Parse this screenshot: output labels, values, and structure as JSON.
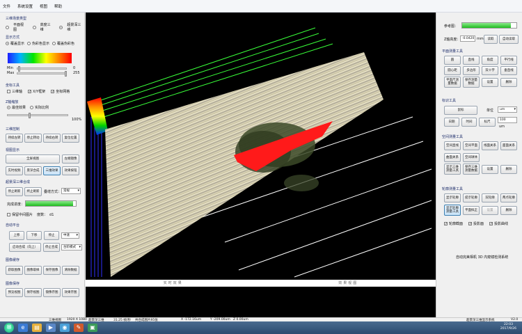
{
  "menu": [
    "文件",
    "系统设置",
    "视图",
    "帮助"
  ],
  "left": {
    "display_type_title": "三维场景类型",
    "display_types": [
      "平面视图",
      "高度三维",
      "超景深三维"
    ],
    "display_mode_title": "显示方式",
    "display_modes": [
      "覆盖显示",
      "伪彩色显示",
      "覆盖伪彩色"
    ],
    "min_label": "Min",
    "min_value": "0",
    "max_label": "Max",
    "max_value": "255",
    "axis_title": "坐标工具",
    "axis_items": [
      "三维轴",
      "X/Y框架",
      "坐标网格"
    ],
    "z_title": "Z轴缩放",
    "z_options": [
      "最佳效果",
      "实际比例"
    ],
    "z_percent": "100%",
    "control_title": "三维控制",
    "control_buttons": [
      "持续左转",
      "停止转动",
      "持续右转",
      "复位位置"
    ],
    "view_title": "视图显示",
    "full_view": "全屏视图",
    "horizontal_mirror": "左端镜像",
    "view_buttons": [
      "实时视频",
      "景深合成",
      "三维效果",
      "效果按钮"
    ],
    "stack_title": "超景深三维合成",
    "stack_buttons": [
      "停止刷新",
      "终止刷新"
    ],
    "stack_mode_label": "叠增方式：",
    "stack_mode_value": "常规",
    "progress_label": "完成进度：",
    "progress_fraction": 0.95,
    "keep_label": "保留中间图片",
    "step_label": "度数：",
    "step_value": "d1",
    "auto_title": "自动平台",
    "auto_buttons": [
      "上移",
      "下移",
      "停止"
    ],
    "speed_value": "中速",
    "auto_stack_button": "启动合成（向上）",
    "stop_stack_button": "停止合成",
    "auto_mode_value": "台阶模式",
    "image_title": "图像缓存",
    "image_buttons": [
      "获取图像",
      "图像取样",
      "保存图像",
      "清除数据"
    ],
    "save_title": "图像保存",
    "save_buttons": [
      "预览视图",
      "保存视图",
      "镜像存图",
      "效果存图"
    ]
  },
  "right": {
    "progress_label": "参考图：",
    "progress_fraction": 0.9,
    "z_height_label": "Z轴高度：",
    "z_height_value": "-0.0420",
    "z_height_unit": "mm",
    "read_button": "读取",
    "auto_read_button": "自动读取",
    "plane_title": "平面测量工具",
    "plane_buttons": [
      "圆",
      "直线",
      "角度",
      "平行线",
      "圆心距",
      "多边形",
      "双十字",
      "垂直线",
      "平面尺测量数据",
      "保存测量数据",
      "设置",
      "删除"
    ],
    "other_title": "标识工具",
    "cursor_button": "鼠标",
    "unit_label": "单位",
    "unit_value": "um",
    "other_buttons": [
      "日期",
      "时间",
      "标尺"
    ],
    "ruler_value": "100",
    "ruler_unit": "um",
    "space_title": "空间测量工具",
    "space_buttons": [
      "空间直线",
      "空间平面",
      "线面关系",
      "面面关系",
      "曲面关系",
      "空间球体",
      "显示三维测量工具",
      "保存三维测量数据",
      "设置",
      "删除"
    ],
    "profile_title": "轮廓测量工具",
    "profile_buttons": [
      "显示轮廓",
      "提示轮廓",
      "双轮廓",
      "两点轮廓",
      "显示轮廓测量工具",
      "平面拟正",
      "设置",
      "删除"
    ],
    "profile_checks": [
      "轮廓截面",
      "投影面",
      "投影曲线"
    ],
    "hint_text": "自动完美相机 3D 内窥镜检测系统"
  },
  "scene": {
    "captions": [
      "实时效果",
      "效果视图"
    ]
  },
  "status": {
    "left": "三维视图",
    "resolution": "1920 X 1080",
    "mode": "超景深三维",
    "fps": "31.25 帧/秒",
    "images": "共合成图片95张",
    "x": "X  -172.16um",
    "y": "Y  -209.00um",
    "z": "Z  0.00um",
    "product": "超景深三维显示系统",
    "version": "V2.0"
  },
  "clock": {
    "time": "22:03",
    "date": "2017/9/26"
  }
}
